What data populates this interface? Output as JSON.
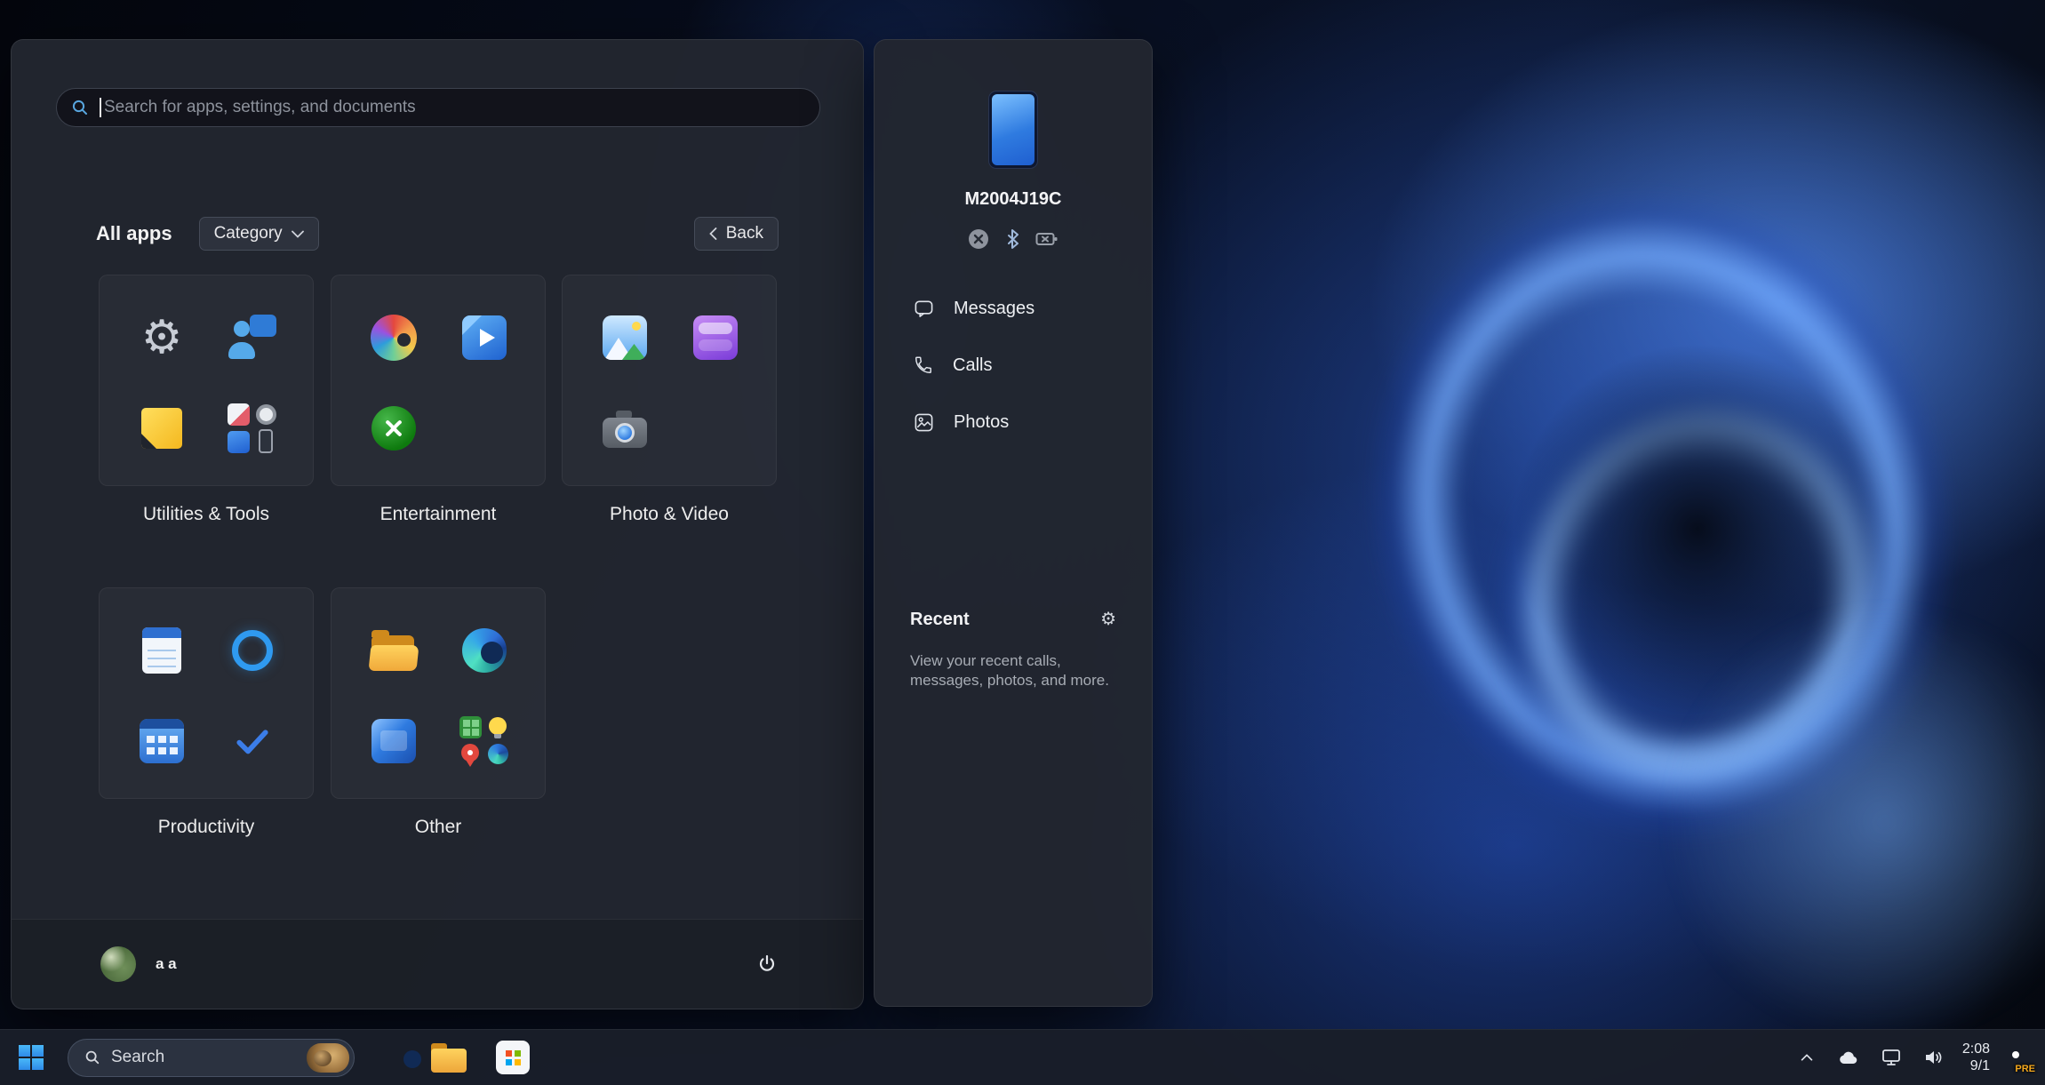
{
  "start_menu": {
    "search": {
      "placeholder": "Search for apps, settings, and documents"
    },
    "header": {
      "title": "All apps",
      "category": "Category",
      "back": "Back"
    },
    "categories": [
      {
        "label": "Utilities & Tools",
        "icons": [
          "settings-gear-icon",
          "feedback-hub-icon",
          "sticky-notes-icon",
          "apps-cluster"
        ]
      },
      {
        "label": "Entertainment",
        "icons": [
          "paint-icon",
          "movies-tv-icon",
          "xbox-icon"
        ]
      },
      {
        "label": "Photo & Video",
        "icons": [
          "photos-icon",
          "video-editor-icon",
          "camera-icon"
        ]
      },
      {
        "label": "Productivity",
        "icons": [
          "notepad-icon",
          "cortana-icon",
          "calendar-icon",
          "todo-check-icon"
        ]
      },
      {
        "label": "Other",
        "icons": [
          "file-explorer-icon",
          "edge-icon",
          "phone-link-icon",
          "apps-cluster"
        ]
      }
    ],
    "footer": {
      "user": "a a"
    }
  },
  "phone_panel": {
    "device_name": "M2004J19C",
    "status_icons": [
      "phone-disconnected-icon",
      "bluetooth-icon",
      "battery-unknown-icon"
    ],
    "items": [
      {
        "label": "Messages"
      },
      {
        "label": "Calls"
      },
      {
        "label": "Photos"
      }
    ],
    "recent": {
      "title": "Recent",
      "description": "View your recent calls, messages, photos, and more."
    }
  },
  "taskbar": {
    "search_label": "Search",
    "apps": [
      "edge-icon",
      "file-explorer-icon",
      "microsoft-store-icon"
    ],
    "tray": [
      "hidden-icons-chevron-icon",
      "onedrive-icon",
      "network-icon",
      "volume-icon"
    ],
    "clock": {
      "time": "2:08",
      "date": "9/1"
    },
    "corner_badge": "PRE"
  },
  "colors": {
    "accent": "#4cc2ff",
    "panel_bg": "#22262f",
    "taskbar_bg": "#191e29"
  }
}
